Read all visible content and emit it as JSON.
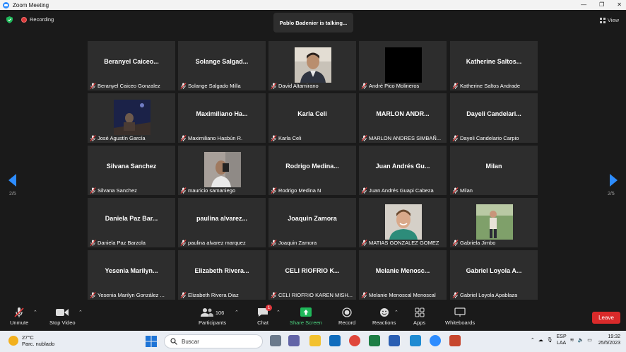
{
  "window": {
    "title": "Zoom Meeting",
    "controls": [
      "—",
      "❐",
      "✕"
    ]
  },
  "topbar": {
    "recording_label": "Recording",
    "talking": "Pablo Badenier is talking...",
    "view_label": "View"
  },
  "pagination": {
    "left": "2/5",
    "right": "2/5"
  },
  "tiles": [
    {
      "display": "Beranyel  Caiceo...",
      "label": "Beranyel Caiceo Gonzalez",
      "photo": ""
    },
    {
      "display": "Solange  Salgad...",
      "label": "Solange Salgado Milla",
      "photo": ""
    },
    {
      "display": "",
      "label": "David Altamirano",
      "photo": "man-portrait"
    },
    {
      "display": "",
      "label": "André Pico Molineros",
      "photo": "black"
    },
    {
      "display": "Katherine  Saltos...",
      "label": "Katherine Saltos Andrade",
      "photo": ""
    },
    {
      "display": "",
      "label": "José Agustín García",
      "photo": "night-scene"
    },
    {
      "display": "Maximiliano  Ha...",
      "label": "Maximiliano Hasbún R.",
      "photo": ""
    },
    {
      "display": "Karla Celi",
      "label": "Karla Celi",
      "photo": ""
    },
    {
      "display": "MARLON  ANDR...",
      "label": "MARLON ANDRES SIMBAÑ...",
      "photo": ""
    },
    {
      "display": "Dayeli  Candelari...",
      "label": "Dayeli Candelario Carpio",
      "photo": ""
    },
    {
      "display": "Silvana Sanchez",
      "label": "Silvana Sanchez",
      "photo": ""
    },
    {
      "display": "",
      "label": "mauricio samaniego",
      "photo": "selfie"
    },
    {
      "display": "Rodrigo  Medina...",
      "label": "Rodrigo Medina N",
      "photo": ""
    },
    {
      "display": "Juan Andrés  Gu...",
      "label": "Juan Andrés Guapi Cabeza",
      "photo": ""
    },
    {
      "display": "Milan",
      "label": "Milan",
      "photo": ""
    },
    {
      "display": "Daniela Paz  Bar...",
      "label": "Daniela Paz Barzola",
      "photo": ""
    },
    {
      "display": "paulina  alvarez...",
      "label": "paulina alvarez marquez",
      "photo": ""
    },
    {
      "display": "Joaquin Zamora",
      "label": "Joaquin Zamora",
      "photo": ""
    },
    {
      "display": "",
      "label": "MATIAS GONZALEZ GOMEZ",
      "photo": "smiling-man"
    },
    {
      "display": "",
      "label": "Gabriela Jimbo",
      "photo": "outdoor"
    },
    {
      "display": "Yesenia  Marilyn...",
      "label": "Yesenia Marilyn González ...",
      "photo": ""
    },
    {
      "display": "Elizabeth  Rivera...",
      "label": "Elizabeth Rivera Diaz",
      "photo": ""
    },
    {
      "display": "CELI  RIOFRIO  K...",
      "label": "CELI RIOFRIO KAREN MISH...",
      "photo": ""
    },
    {
      "display": "Melanie  Menosc...",
      "label": "Melanie Menoscal Menoscal",
      "photo": ""
    },
    {
      "display": "Gabriel  Loyola  A...",
      "label": "Gabriel Loyola Apablaza",
      "photo": ""
    }
  ],
  "toolbar": {
    "unmute": "Unmute",
    "stop_video": "Stop Video",
    "participants": "Participants",
    "participants_count": "106",
    "chat": "Chat",
    "chat_badge": "1",
    "share_screen": "Share Screen",
    "record": "Record",
    "reactions": "Reactions",
    "apps": "Apps",
    "whiteboards": "Whiteboards",
    "leave": "Leave"
  },
  "colors": {
    "accent_green": "#1fb85a",
    "leave_red": "#d92a2a",
    "zoom_blue": "#2d8cff",
    "nav_blue": "#2d8cff"
  },
  "taskbar": {
    "temp": "27°C",
    "weather": "Parc. nublado",
    "search_placeholder": "Buscar",
    "lang1": "ESP",
    "lang2": "LAA",
    "time": "19:32",
    "date": "25/5/2023"
  }
}
